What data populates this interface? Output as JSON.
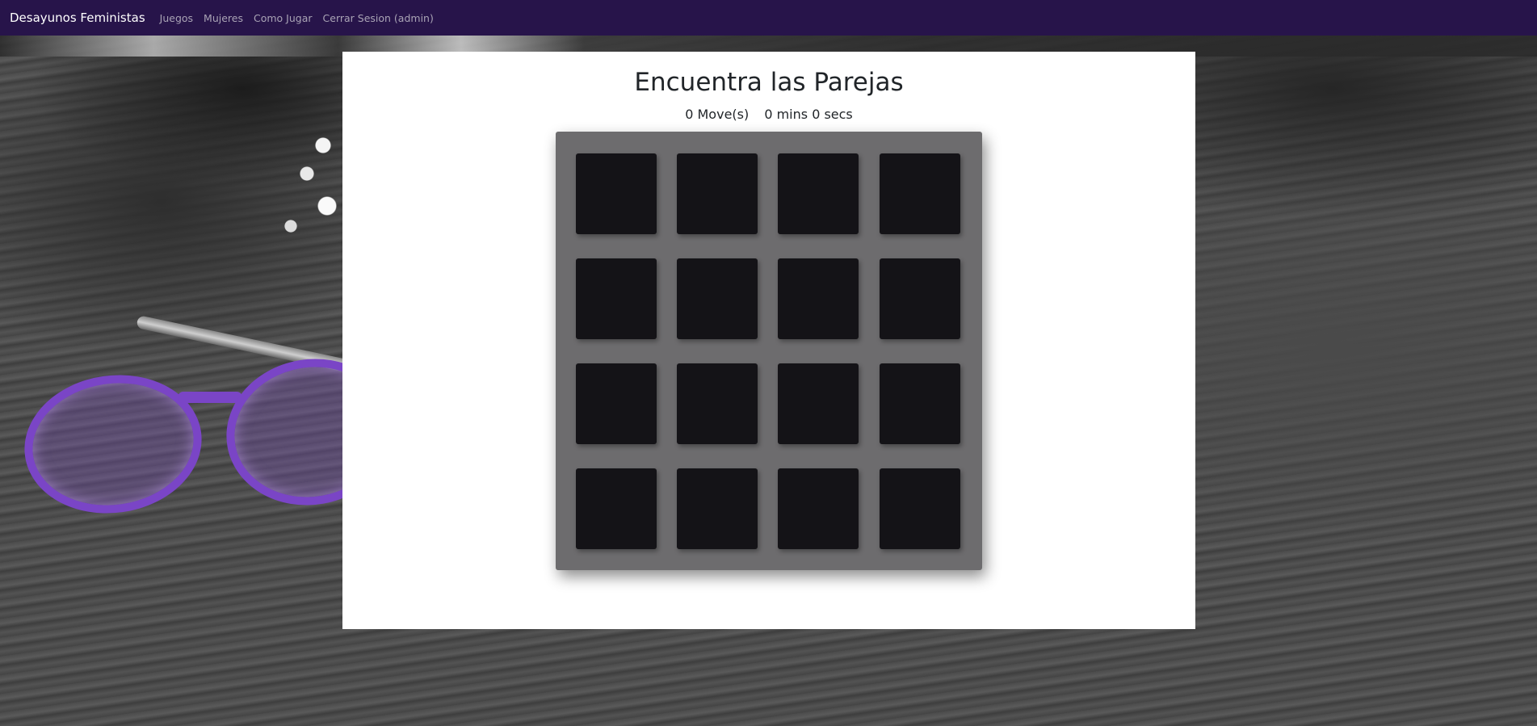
{
  "navbar": {
    "brand": "Desayunos Feministas",
    "links": [
      {
        "label": "Juegos"
      },
      {
        "label": "Mujeres"
      },
      {
        "label": "Como Jugar"
      },
      {
        "label": "Cerrar Sesion (admin)"
      }
    ]
  },
  "game": {
    "title": "Encuentra las Parejas",
    "moves_text": "0 Move(s)",
    "timer_text": "0 mins 0 secs",
    "grid": {
      "rows": 4,
      "cols": 4
    }
  },
  "colors": {
    "navbar_bg": "#27144a",
    "deck_bg": "#6d6c6e",
    "card_back": "#141317",
    "panel_bg": "#ffffff"
  }
}
